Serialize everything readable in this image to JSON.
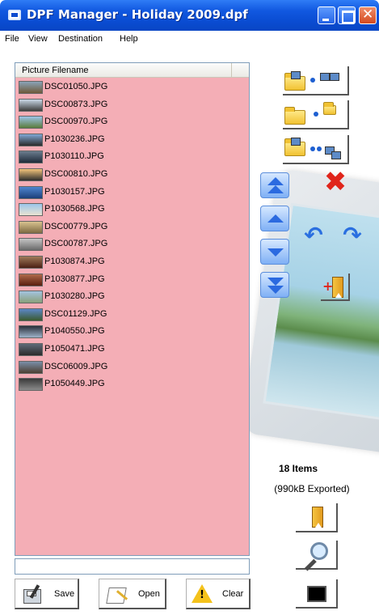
{
  "window": {
    "title": "DPF Manager - Holiday 2009.dpf"
  },
  "menu": [
    "File",
    "View",
    "Destination",
    "Help"
  ],
  "list": {
    "column_header": "Picture Filename",
    "background": "#f4aeb6",
    "items": [
      "DSC01050.JPG",
      "DSC00873.JPG",
      "DSC00970.JPG",
      "P1030236.JPG",
      "P1030110.JPG",
      "DSC00810.JPG",
      "P1030157.JPG",
      "P1030568.JPG",
      "DSC00779.JPG",
      "DSC00787.JPG",
      "P1030874.JPG",
      "P1030877.JPG",
      "P1030280.JPG",
      "DSC01129.JPG",
      "P1040550.JPG",
      "P1050471.JPG",
      "DSC06009.JPG",
      "P1050449.JPG"
    ]
  },
  "status": {
    "items": "18 Items",
    "exported": "(990kB Exported)"
  },
  "buttons": {
    "save": "Save",
    "open": "Open",
    "clear": "Clear"
  },
  "icons": {
    "add_pictures": "folder-add-picture-icon",
    "add_folder": "folder-add-icon",
    "add_folder_tree": "folder-tree-icon",
    "delete": "delete-x-icon",
    "move_top": "double-up-arrow-icon",
    "move_up": "up-arrow-icon",
    "move_down": "down-arrow-icon",
    "move_bottom": "double-down-arrow-icon",
    "rotate_left": "rotate-left-icon",
    "rotate_right": "rotate-right-icon",
    "add_bookmark": "add-bookmark-icon",
    "bookmark": "bookmark-icon",
    "preview": "magnifier-icon",
    "export": "device-export-icon"
  }
}
